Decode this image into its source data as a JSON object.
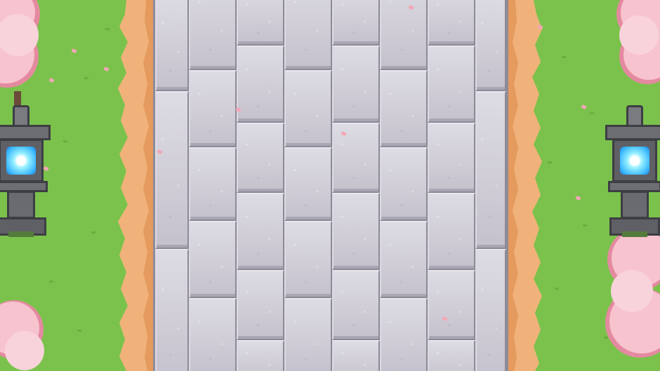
{
  "scene": {
    "type": "top-down pixel-art garden path",
    "colors": {
      "grass": "#7bc24c",
      "grass_dark": "#6aae40",
      "dirt": "#f0b27a",
      "dirt_dark": "#e59a5e",
      "stone": "#d2cfd8",
      "stone_edge": "#8d8a96",
      "blossom": "#f7c3cf",
      "blossom_dark": "#e48aa0",
      "lantern_stone": "#6d6e72",
      "lantern_glow": "#3ab8ff",
      "petal": "#f2a7b6"
    },
    "objects": {
      "left_lantern_icon": "stone-lantern-icon",
      "right_lantern_icon": "stone-lantern-icon",
      "tree_icon": "cherry-blossom-tree-icon",
      "petal_icon": "petal-icon"
    }
  }
}
